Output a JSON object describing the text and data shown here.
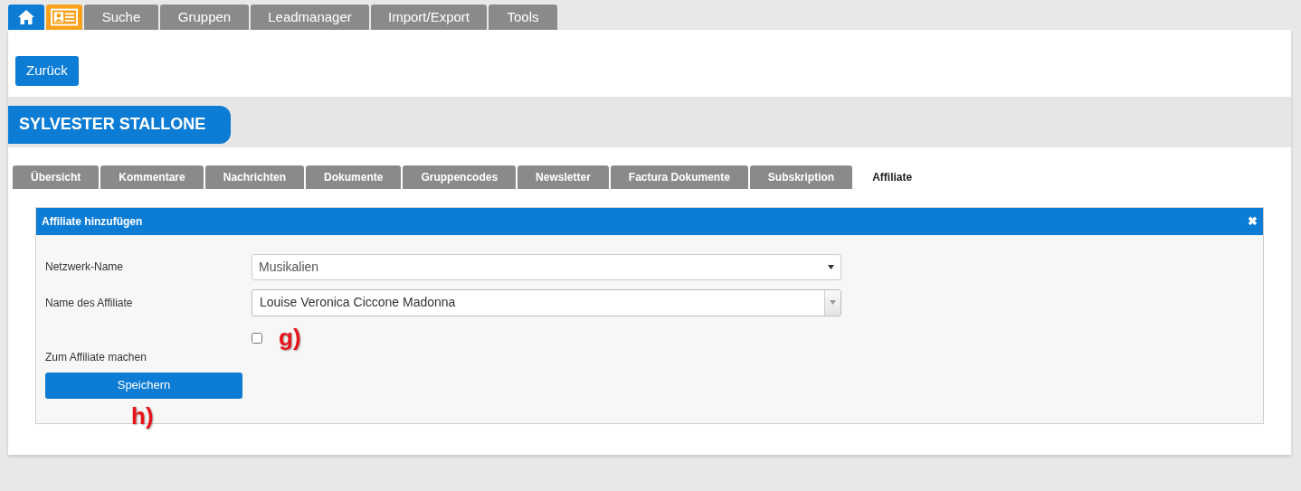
{
  "top_nav": [
    {
      "kind": "home",
      "color": "#0c7cd5"
    },
    {
      "kind": "contact",
      "color": "#f9a11b"
    },
    {
      "kind": "text",
      "label": "Suche",
      "color": "#8a8a8a"
    },
    {
      "kind": "text",
      "label": "Gruppen",
      "color": "#8a8a8a"
    },
    {
      "kind": "text",
      "label": "Leadmanager",
      "color": "#8a8a8a"
    },
    {
      "kind": "text",
      "label": "Import/Export",
      "color": "#8a8a8a"
    },
    {
      "kind": "text",
      "label": "Tools",
      "color": "#8a8a8a"
    }
  ],
  "back_button": "Zurück",
  "contact_name": "SYLVESTER STALLONE",
  "tabs": [
    {
      "label": "Übersicht",
      "selected": false
    },
    {
      "label": "Kommentare",
      "selected": false
    },
    {
      "label": "Nachrichten",
      "selected": false
    },
    {
      "label": "Dokumente",
      "selected": false
    },
    {
      "label": "Gruppencodes",
      "selected": false
    },
    {
      "label": "Newsletter",
      "selected": false
    },
    {
      "label": "Factura Dokumente",
      "selected": false
    },
    {
      "label": "Subskription",
      "selected": false
    },
    {
      "label": "Affiliate",
      "selected": true
    }
  ],
  "panel": {
    "title": "Affiliate hinzufügen",
    "close": "✖",
    "fields": [
      {
        "kind": "select",
        "label": "Netzwerk-Name",
        "value": "Musikalien"
      },
      {
        "kind": "combo",
        "label": "Name des Affiliate",
        "value": "Louise Veronica Ciccone Madonna"
      },
      {
        "kind": "checkbox",
        "label": "Zum Affiliate machen",
        "checked": false,
        "annotation": "g)"
      }
    ],
    "submit": {
      "label": "Speichern",
      "annotation": "h)"
    }
  }
}
